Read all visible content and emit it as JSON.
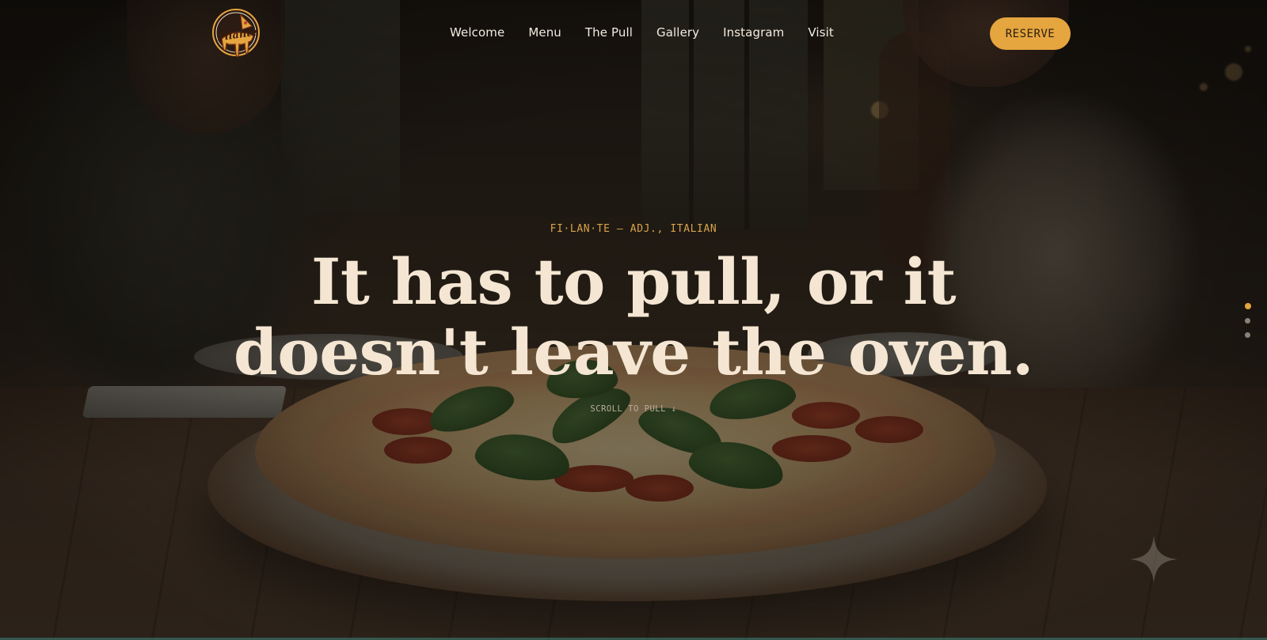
{
  "brand": {
    "logo_text": "Filante"
  },
  "nav": {
    "items": [
      {
        "label": "Welcome"
      },
      {
        "label": "Menu"
      },
      {
        "label": "The Pull"
      },
      {
        "label": "Gallery"
      },
      {
        "label": "Instagram"
      },
      {
        "label": "Visit"
      }
    ],
    "reserve_label": "RESERVE"
  },
  "hero": {
    "eyebrow": "FI·LAN·TE — ADJ., ITALIAN",
    "headline": "It has to pull, or it doesn't leave the oven.",
    "scroll_hint": "SCROLL TO PULL ↓"
  },
  "slider": {
    "count": 3,
    "active_index": 0
  },
  "colors": {
    "accent": "#e5a53f",
    "headline": "#f4e6d2",
    "nav_text": "#f2ebe0",
    "dot_inactive": "#8a8275"
  },
  "icons": [
    "logo-badge-icon",
    "sparkle-icon"
  ]
}
